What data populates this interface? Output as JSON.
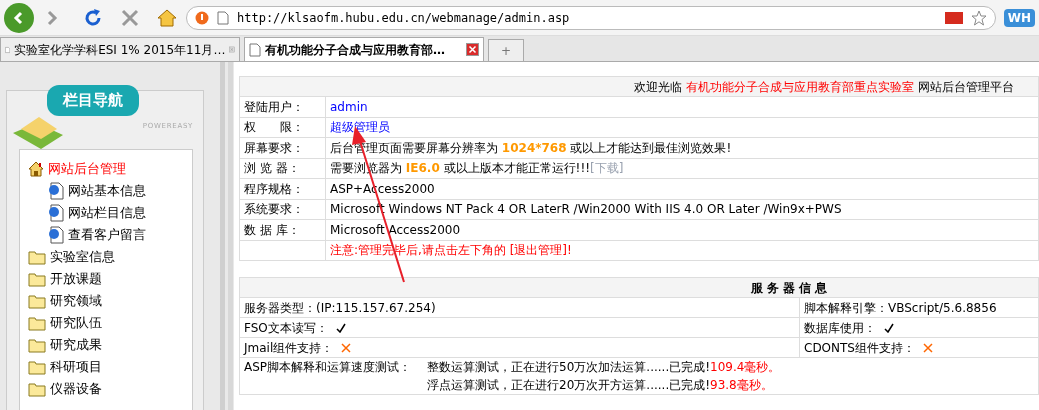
{
  "browser": {
    "url": "http://klsaofm.hubu.edu.cn/webmanage/admin.asp",
    "badge": "WH",
    "tabs": [
      {
        "title": "实验室化学学科ESI 1% 2015年11月…",
        "selected": false
      },
      {
        "title": "有机功能分子合成与应用教育部…",
        "selected": true
      }
    ],
    "new_tab": "+"
  },
  "sidebar": {
    "title": "栏目导航",
    "brand": "POWEREASY",
    "items": [
      {
        "label": "网站后台管理",
        "kind": "home",
        "children": [
          {
            "label": "网站基本信息",
            "kind": "page"
          },
          {
            "label": "网站栏目信息",
            "kind": "page"
          },
          {
            "label": "查看客户留言",
            "kind": "page"
          }
        ]
      },
      {
        "label": "实验室信息",
        "kind": "folder"
      },
      {
        "label": "开放课题",
        "kind": "folder"
      },
      {
        "label": "研究领域",
        "kind": "folder"
      },
      {
        "label": "研究队伍",
        "kind": "folder"
      },
      {
        "label": "研究成果",
        "kind": "folder"
      },
      {
        "label": "科研项目",
        "kind": "folder"
      },
      {
        "label": "仪器设备",
        "kind": "folder"
      }
    ]
  },
  "welcome": {
    "prefix": "欢迎光临",
    "site_name": "有机功能分子合成与应用教育部重点实验室",
    "suffix": "网站后台管理平台"
  },
  "info_rows": [
    {
      "label": "登陆用户：",
      "value": [
        {
          "text": "admin",
          "kind": "user"
        }
      ]
    },
    {
      "label": "权　　限：",
      "value": [
        {
          "text": "超级管理员",
          "kind": "user"
        }
      ]
    },
    {
      "label": "屏幕要求：",
      "value": [
        {
          "text": "后台管理页面需要屏幕分辨率为 ",
          "kind": "plain"
        },
        {
          "text": "1024*768",
          "kind": "highlight"
        },
        {
          "text": " 或以上才能达到最佳浏览效果!",
          "kind": "plain"
        }
      ]
    },
    {
      "label": "浏 览 器：",
      "value": [
        {
          "text": "需要浏览器为 ",
          "kind": "plain"
        },
        {
          "text": "IE6.0",
          "kind": "highlight"
        },
        {
          "text": " 或以上版本才能正常运行!!!",
          "kind": "plain"
        },
        {
          "text": "[下载]",
          "kind": "muted"
        }
      ]
    },
    {
      "label": "程序规格：",
      "value": [
        {
          "text": "ASP+Access2000",
          "kind": "plain"
        }
      ]
    },
    {
      "label": "系统要求：",
      "value": [
        {
          "text": "Microsoft Windows NT Pack 4 OR LaterR /Win2000 With IIS 4.0 OR Later /Win9x+PWS",
          "kind": "plain"
        }
      ]
    },
    {
      "label": "数 据 库：",
      "value": [
        {
          "text": "Microsoft Access2000",
          "kind": "plain"
        }
      ]
    },
    {
      "label": "",
      "value": [
        {
          "text": "注意:管理完毕后,请点击左下角的 [退出管理]!",
          "kind": "warning"
        }
      ]
    }
  ],
  "server": {
    "title": "服 务 器 信 息",
    "rows": [
      [
        {
          "label": "服务器类型：(IP:115.157.67.254)"
        },
        {
          "label": "脚本解释引擎：VBScript/5.6.8856"
        }
      ],
      [
        {
          "label": "FSO文本读写：",
          "supported": true
        },
        {
          "label": "数据库使用：",
          "supported": true
        }
      ],
      [
        {
          "label": "Jmail组件支持：",
          "supported": false
        },
        {
          "label": "CDONTS组件支持：",
          "supported": false
        }
      ]
    ],
    "speed_test": {
      "label": "ASP脚本解释和运算速度测试：",
      "lines": [
        {
          "text": "整数运算测试，正在进行50万次加法运算......已完成!",
          "time": "109.4毫秒。"
        },
        {
          "text": "浮点运算测试，正在进行20万次开方运算......已完成!",
          "time": "93.8毫秒。"
        }
      ]
    }
  }
}
